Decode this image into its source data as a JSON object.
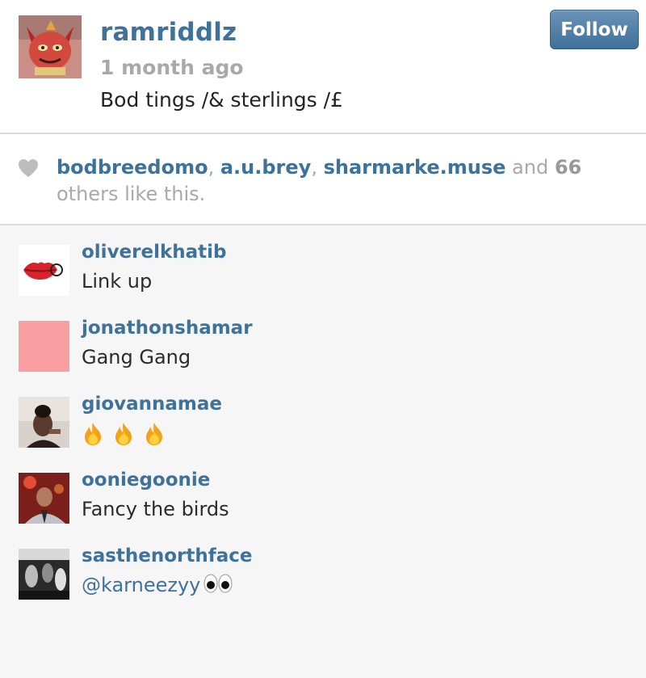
{
  "post": {
    "username": "ramriddlz",
    "time_ago": "1 month ago",
    "caption": "Bod tings /& sterlings /£",
    "follow_label": "Follow",
    "avatar_icon": "devil-mask-avatar"
  },
  "likes": {
    "heart_icon": "heart-icon",
    "users": [
      "bodbreedomo",
      "a.u.brey",
      "sharmarke.muse"
    ],
    "sep": ", ",
    "and_word": " and ",
    "count": "66",
    "suffix": " others like this."
  },
  "comments": [
    {
      "username": "oliverelkhatib",
      "text": "Link up",
      "avatar": "lips-avatar"
    },
    {
      "username": "jonathonshamar",
      "text": "Gang Gang",
      "avatar": "pink-square-avatar"
    },
    {
      "username": "giovannamae",
      "text": "",
      "avatar": "photo-avatar",
      "emoji": "fire-emoji x3"
    },
    {
      "username": "ooniegoonie",
      "text": "Fancy the birds",
      "avatar": "photo-avatar"
    },
    {
      "username": "sasthenorthface",
      "text": "",
      "mention": "@karneezyy",
      "avatar": "photo-avatar",
      "emoji": "eyes-emoji"
    }
  ],
  "colors": {
    "link_blue": "#3f729b",
    "follow_button": "#517fa4",
    "muted_gray": "#a9a9a9",
    "background": "#f6f6f6"
  }
}
